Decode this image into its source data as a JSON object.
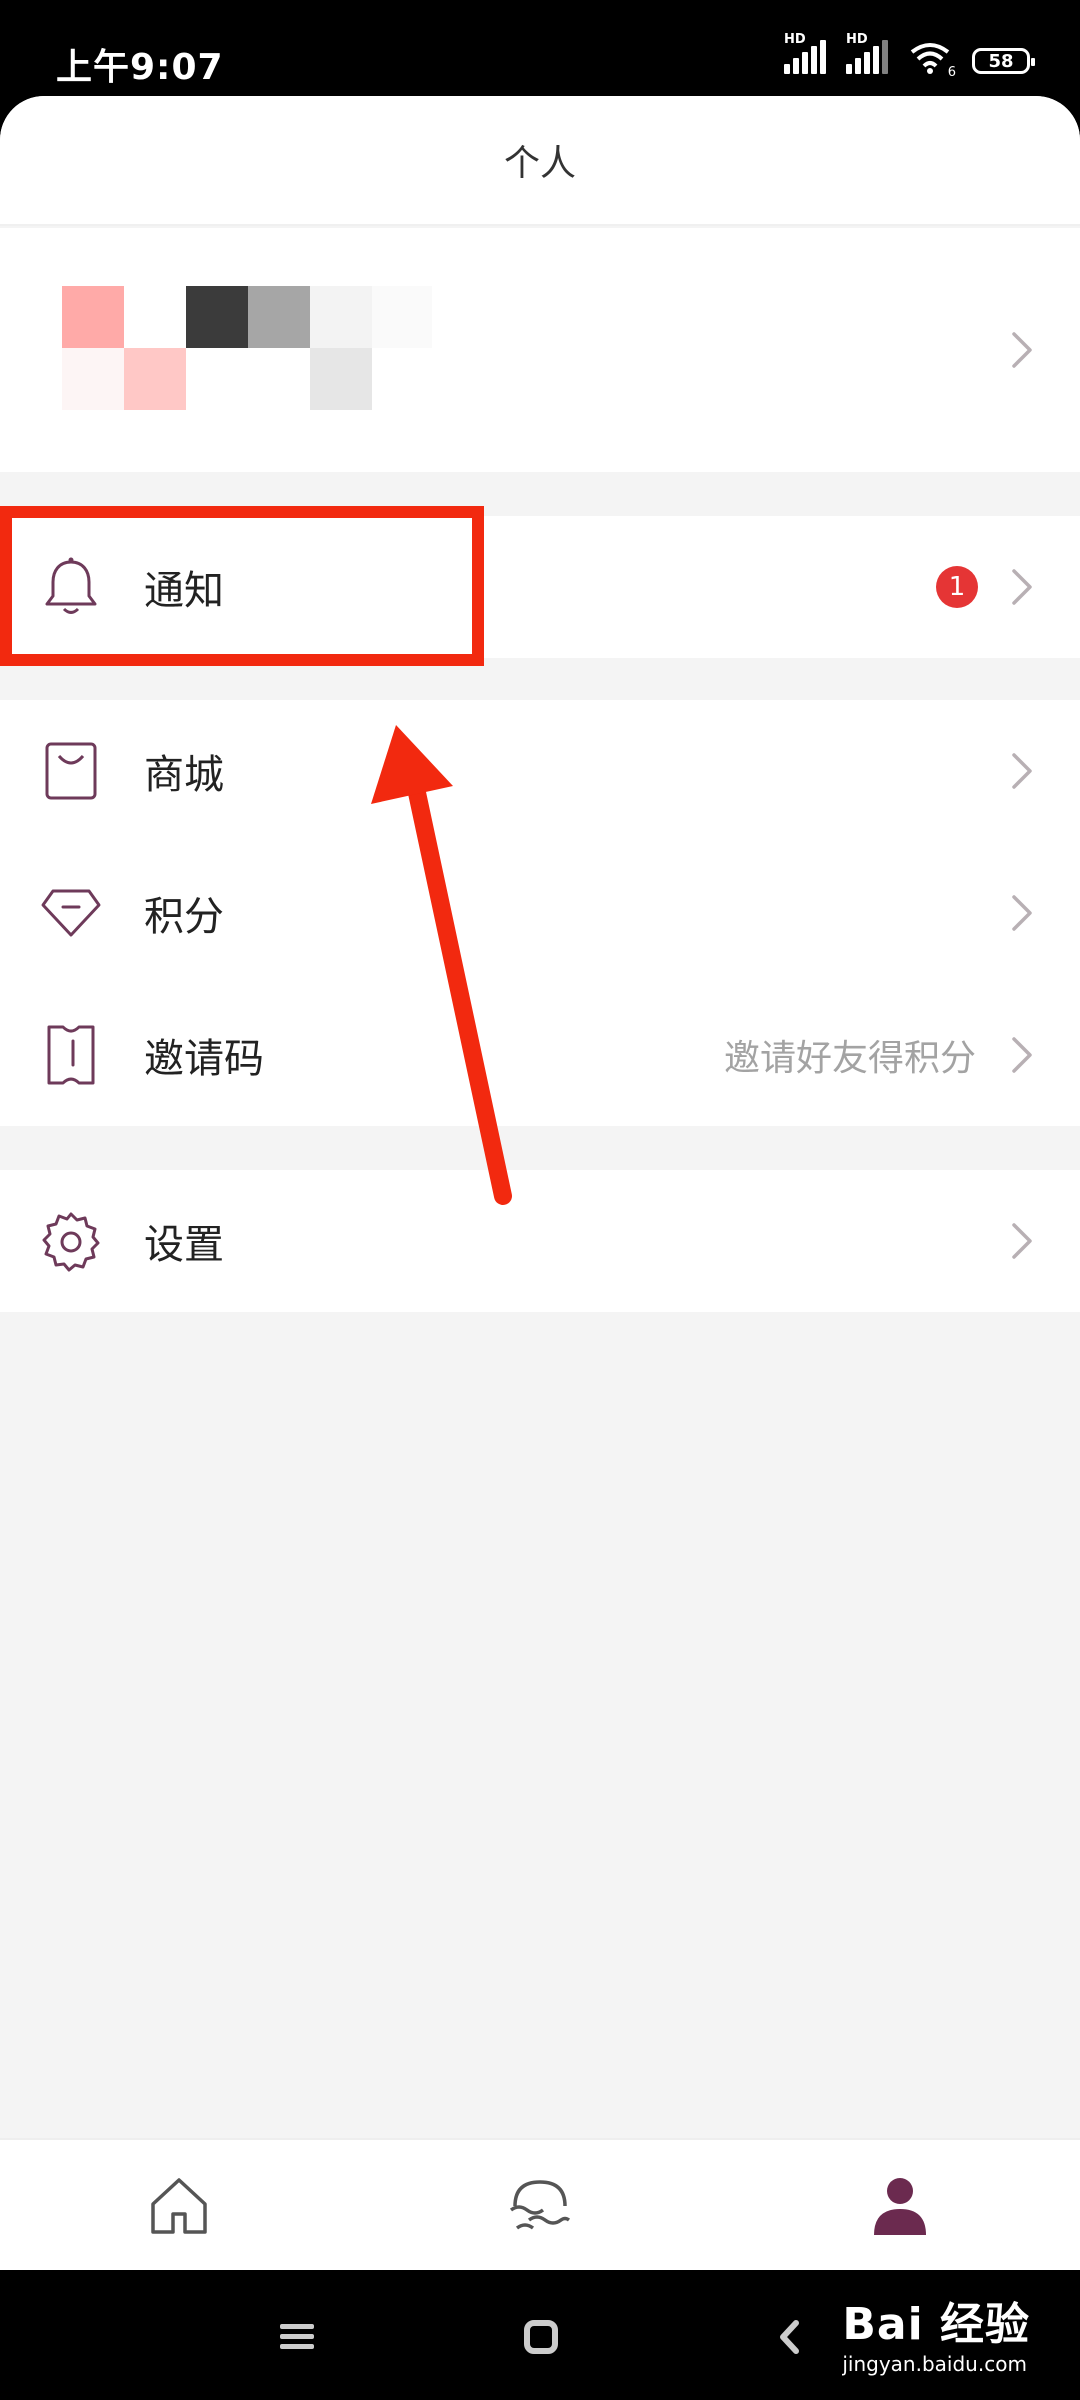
{
  "status_bar": {
    "time": "上午9:07",
    "battery": "58",
    "signal_label_1": "HD",
    "signal_label_2": "HD",
    "wifi_badge": "6"
  },
  "header": {
    "title": "个人"
  },
  "menu_group_1": [
    {
      "label": "通知",
      "badge": "1",
      "icon": "bell-icon"
    }
  ],
  "menu_group_2": [
    {
      "label": "商城",
      "icon": "shopping-bag-icon"
    },
    {
      "label": "积分",
      "icon": "diamond-icon"
    },
    {
      "label": "邀请码",
      "value": "邀请好友得积分",
      "icon": "ticket-icon"
    }
  ],
  "menu_group_3": [
    {
      "label": "设置",
      "icon": "gear-icon"
    }
  ],
  "tabbar": {
    "items": [
      {
        "icon": "home-icon",
        "active": false
      },
      {
        "icon": "discover-icon",
        "active": false
      },
      {
        "icon": "profile-icon",
        "active": true
      }
    ]
  },
  "watermark": {
    "logo": "Bai 经验",
    "url": "jingyan.baidu.com"
  },
  "colors": {
    "accent": "#6b2a4f",
    "icon_stroke": "#6e3a5a",
    "badge": "#e53535",
    "highlight": "#f2290f",
    "chevron": "#b8b0b4"
  }
}
